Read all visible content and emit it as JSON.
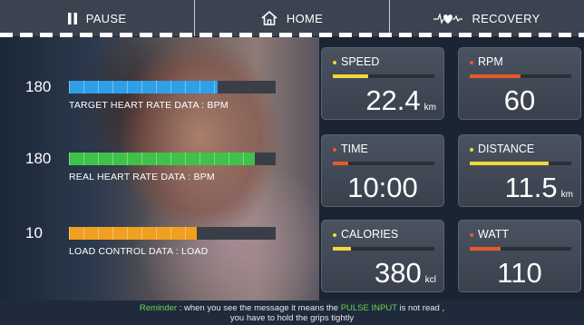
{
  "topbar": {
    "pause_label": "PAUSE",
    "home_label": "HOME",
    "recovery_label": "RECOVERY"
  },
  "metrics": [
    {
      "value": "180",
      "label": "TARGET HEART RATE DATA : BPM",
      "fill_fraction": 0.72,
      "color": "#2f9fe8"
    },
    {
      "value": "180",
      "label": "REAL HEART RATE DATA : BPM",
      "fill_fraction": 0.9,
      "color": "#3fc14a"
    },
    {
      "value": "10",
      "label": "LOAD CONTROL DATA : LOAD",
      "fill_fraction": 0.62,
      "color": "#f0a020"
    }
  ],
  "tiles": {
    "speed": {
      "title": "SPEED",
      "value": "22.4",
      "unit": "km",
      "dot_color": "#f2d83a",
      "bar_color": "#f2d83a",
      "bar_fraction": 0.35
    },
    "rpm": {
      "title": "RPM",
      "value": "60",
      "unit": "",
      "dot_color": "#e8592a",
      "bar_color": "#e8592a",
      "bar_fraction": 0.5
    },
    "time": {
      "title": "TIME",
      "value": "10:00",
      "unit": "",
      "dot_color": "#e8592a",
      "bar_color": "#e8592a",
      "bar_fraction": 0.15
    },
    "distance": {
      "title": "DISTANCE",
      "value": "11.5",
      "unit": "km",
      "dot_color": "#f2d83a",
      "bar_color": "#f2d83a",
      "bar_fraction": 0.78
    },
    "calories": {
      "title": "CALORIES",
      "value": "380",
      "unit": "kcl",
      "dot_color": "#f2d83a",
      "bar_color": "#f2d83a",
      "bar_fraction": 0.18
    },
    "watt": {
      "title": "WATT",
      "value": "110",
      "unit": "",
      "dot_color": "#e8592a",
      "bar_color": "#e8592a",
      "bar_fraction": 0.3
    }
  },
  "footer": {
    "reminder_word": "Reminder",
    "text_part1": " : when you see the message it means the ",
    "highlight": "PULSE INPUT",
    "text_part2": " is not read ,",
    "line2": "you have to hold the grips tightly"
  }
}
